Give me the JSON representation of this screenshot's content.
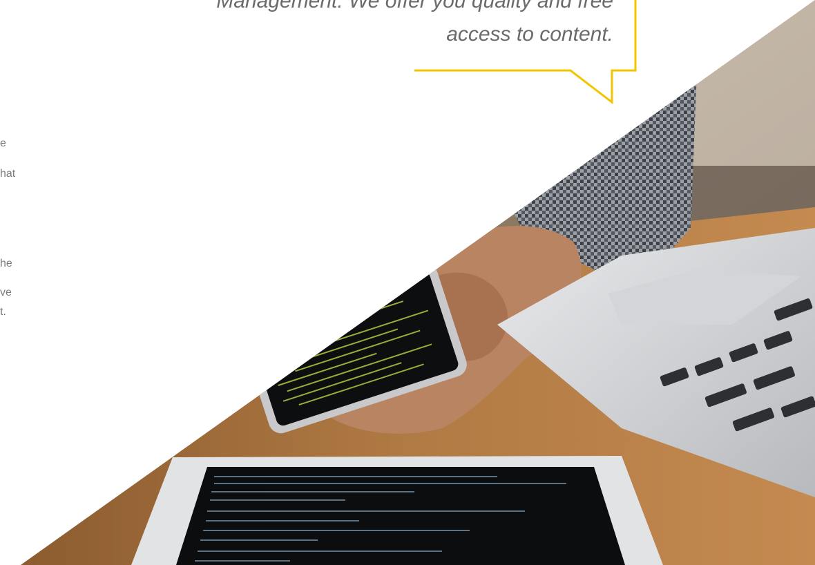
{
  "quote": {
    "line1": "Management. We offer you quality and free",
    "line2": "access to content."
  },
  "side_fragments": [
    "e",
    "hat",
    "he",
    "ve",
    "t."
  ],
  "colors": {
    "accent": "#f2c500",
    "quote_text": "#6b6b6b",
    "side_text": "#7a7a7a"
  },
  "photo": {
    "subject": "hands-holding-phone-with-code-laptop-tablet"
  }
}
